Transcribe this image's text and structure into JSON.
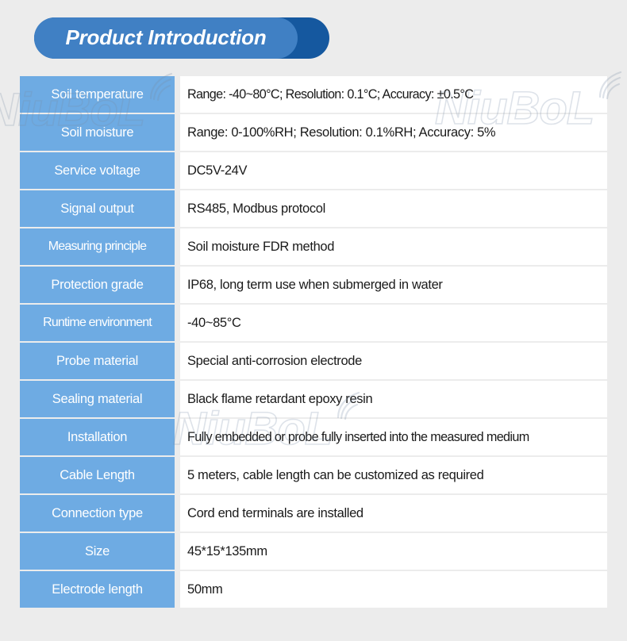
{
  "header": {
    "title": "Product Introduction",
    "back_pill_color": "#15589f",
    "front_pill_color": "#4080c4",
    "title_color": "#ffffff"
  },
  "theme": {
    "page_background": "#ececec",
    "label_cell_color": "#6eabe3",
    "value_cell_color": "#ffffff",
    "value_text_color": "#1a1a1a"
  },
  "watermark": {
    "text": "NiuBoL",
    "icon": "wifi-signal-icon"
  },
  "spec_table": {
    "rows": [
      {
        "label": "Soil temperature",
        "value": "Range: -40~80°C;  Resolution: 0.1°C;  Accuracy: ±0.5°C"
      },
      {
        "label": "Soil moisture",
        "value": "Range: 0-100%RH;  Resolution: 0.1%RH;  Accuracy: 5%"
      },
      {
        "label": "Service voltage",
        "value": "DC5V-24V"
      },
      {
        "label": "Signal output",
        "value": "RS485, Modbus protocol"
      },
      {
        "label": "Measuring principle",
        "value": "Soil moisture FDR method"
      },
      {
        "label": "Protection grade",
        "value": "IP68, long term use when submerged in water"
      },
      {
        "label": "Runtime environment",
        "value": "-40~85°C"
      },
      {
        "label": "Probe material",
        "value": "Special anti-corrosion electrode"
      },
      {
        "label": "Sealing material",
        "value": "Black flame retardant epoxy resin"
      },
      {
        "label": "Installation",
        "value": "Fully embedded or probe fully inserted into the measured medium"
      },
      {
        "label": "Cable Length",
        "value": "5 meters, cable length can be customized as required"
      },
      {
        "label": "Connection type",
        "value": "Cord end terminals are installed"
      },
      {
        "label": "Size",
        "value": "45*15*135mm"
      },
      {
        "label": "Electrode length",
        "value": "50mm"
      }
    ]
  }
}
